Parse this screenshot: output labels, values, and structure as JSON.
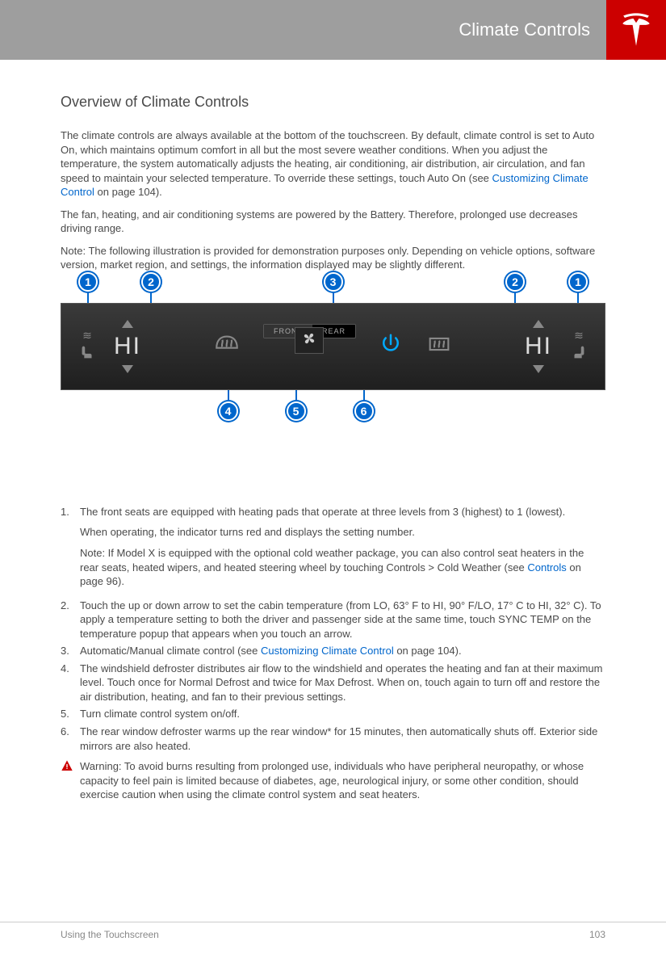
{
  "header": {
    "title": "Climate Controls"
  },
  "section_heading": "Overview of Climate Controls",
  "paragraphs": {
    "p1a": "The climate controls are always available at the bottom of the touchscreen. By default, climate control is set to Auto On, which maintains optimum comfort in all but the most severe weather conditions. When you adjust the temperature, the system automatically adjusts the heating, air conditioning, air distribution, air circulation, and fan speed to maintain your selected temperature. To override these settings, touch Auto On (see ",
    "p1link": "Customizing Climate Control",
    "p1b": " on page 104).",
    "p2": "The fan, heating, and air conditioning systems are powered by the Battery. Therefore, prolonged use decreases driving range.",
    "p3": "Note: The following illustration is provided for demonstration purposes only. Depending on vehicle options, software version, market region, and settings, the information displayed may be slightly different."
  },
  "climate_bar": {
    "temp_left": "HI",
    "temp_right": "HI",
    "tab_front": "FRONT",
    "tab_rear": "REAR"
  },
  "callouts": {
    "c1": "1",
    "c2": "2",
    "c3": "3",
    "c4": "4",
    "c5": "5",
    "c6": "6"
  },
  "list": {
    "item1": {
      "num": "1.",
      "main": "The front seats are equipped with heating pads that operate at three levels from 3 (highest) to 1 (lowest).",
      "sub1": "When operating, the indicator turns red and displays the setting number.",
      "sub2a": "Note: If Model X is equipped with the optional cold weather package, you can also control seat heaters in the rear seats, heated wipers, and heated steering wheel by touching Controls > Cold Weather (see ",
      "sub2link": "Controls",
      "sub2b": " on page 96)."
    },
    "item2": {
      "num": "2.",
      "text": "Touch the up or down arrow to set the cabin temperature (from LO, 63° F to HI, 90° F/LO, 17° C to HI, 32° C). To apply a temperature setting to both the driver and passenger side at the same time, touch SYNC TEMP on the temperature popup that appears when you touch an arrow."
    },
    "item3": {
      "num": "3.",
      "text_a": "Automatic/Manual climate control (see ",
      "link": "Customizing Climate Control",
      "text_b": " on page 104)."
    },
    "item4": {
      "num": "4.",
      "text": "The windshield defroster distributes air flow to the windshield and operates the heating and fan at their maximum level. Touch once for Normal Defrost and twice for Max Defrost. When on, touch again to turn off and restore the air distribution, heating, and fan to their previous settings."
    },
    "item5": {
      "num": "5.",
      "text": "Turn climate control system on/off."
    },
    "item6": {
      "num": "6.",
      "text": "The rear window defroster warms up the rear window* for 15 minutes, then automatically shuts off. Exterior side mirrors are also heated."
    }
  },
  "warning": "Warning: To avoid burns resulting from prolonged use, individuals who have peripheral neuropathy, or whose capacity to feel pain is limited because of diabetes, age, neurological injury, or some other condition, should exercise caution when using the climate control system and seat heaters.",
  "footer": {
    "left": "Using the Touchscreen",
    "right": "103"
  }
}
